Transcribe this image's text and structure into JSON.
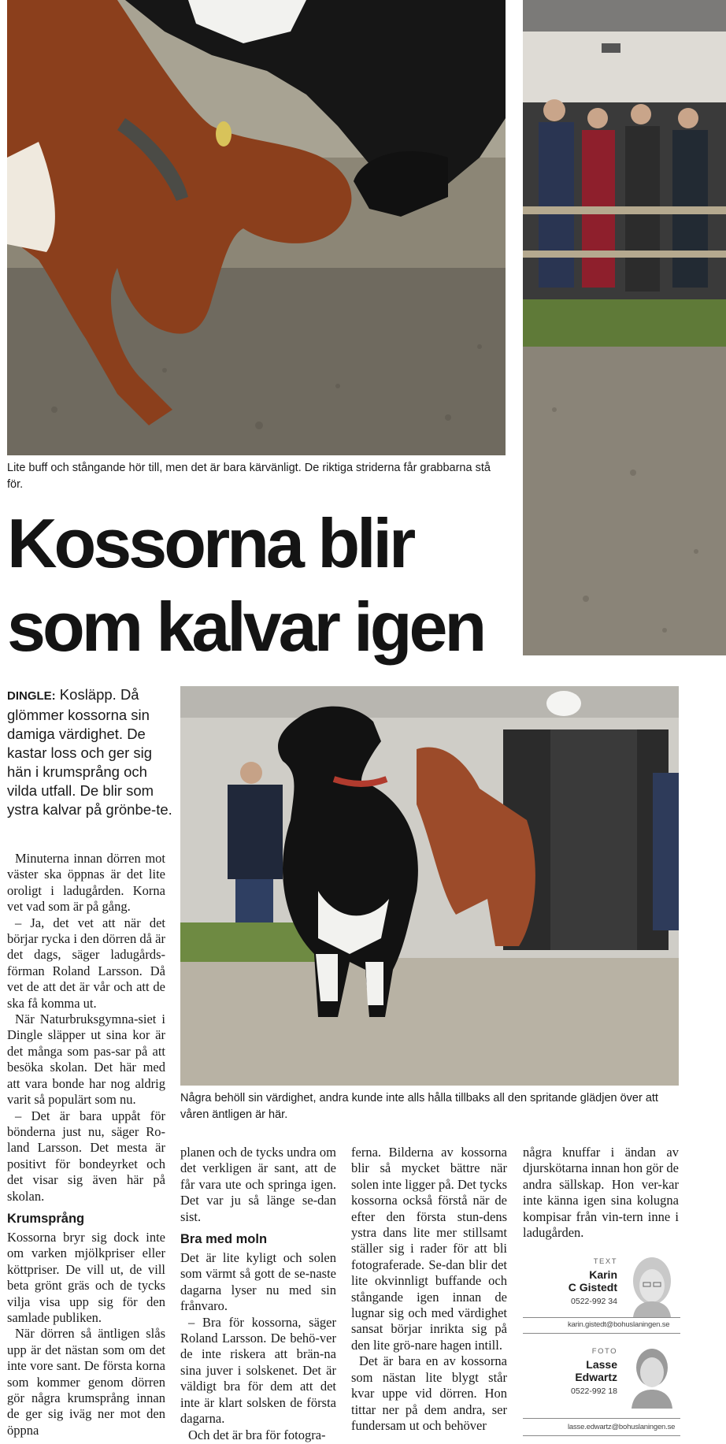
{
  "photos": {
    "top_caption": "Lite buff och stångande hör till, men det är bara kärvänligt. De riktiga striderna får grabbarna stå för.",
    "mid_caption": "Några behöll sin värdighet, andra kunde inte alls hålla tillbaks all den spritande glädjen över att våren äntligen är här."
  },
  "headline": {
    "line1": "Kossorna blir",
    "line2": "som kalvar igen"
  },
  "lead": {
    "dateline": "DINGLE:",
    "text": " Kosläpp. Då glömmer kossorna sin damiga värdighet. De kastar loss och ger sig hän i krumsprång och vilda utfall. De blir som ystra kalvar på grönbe-te."
  },
  "body": {
    "col1": [
      "Minuterna innan dörren mot väster ska öppnas är det lite oroligt i ladugården. Korna vet vad som är på gång.",
      "– Ja, det vet att när det börjar rycka i den dörren då är det dags, säger ladugårds-förman Roland Larsson. Då vet de att det är vår och att de ska få komma ut.",
      "När Naturbruksgymna-siet i Dingle släpper ut sina kor är det många som pas-sar på att besöka skolan. Det här med att vara bonde har nog aldrig varit så populärt som nu.",
      "– Det är bara uppåt för bönderna just nu, säger Ro-land Larsson. Det mesta är positivt för bondeyrket och det visar sig även här på skolan."
    ],
    "subhead1": "Krumsprång",
    "col1b": [
      "Kossorna bryr sig dock inte om varken mjölkpriser eller köttpriser. De vill ut, de vill beta grönt gräs och de tycks vilja visa upp sig för den samlade publiken.",
      "När dörren så äntligen slås upp är det nästan som om det inte vore sant. De första korna som kommer genom dörren gör några krumsprång innan de ger sig iväg ner mot den öppna"
    ],
    "col2a": "planen och de tycks undra om det verkligen är sant, att de får vara ute och springa igen. Det var ju så länge se-dan sist.",
    "subhead2": "Bra med moln",
    "col2": [
      "Det är lite kyligt och solen som värmt så gott de se-naste dagarna lyser nu med sin frånvaro.",
      "– Bra för kossorna, säger Roland Larsson. De behö-ver de inte riskera att brän-na sina juver i solskenet. Det är väldigt bra för dem att det inte är klart solsken de första dagarna.",
      "Och det är bra för fotogra-"
    ],
    "col3": [
      "ferna. Bilderna av kossorna blir så mycket bättre när solen inte ligger på. Det tycks kossorna också förstå när de efter den första stun-dens ystra dans lite mer stillsamt ställer sig i rader för att bli fotograferade. Se-dan blir det lite okvinnligt buffande och stångande igen innan de lugnar sig och med värdighet sansat börjar inrikta sig på den lite grö-nare hagen intill.",
      "Det är bara en av kossorna som nästan lite blygt står kvar uppe vid dörren. Hon tittar ner på dem andra, ser fundersam ut och behöver"
    ],
    "col4": "några knuffar i ändan av djurskötarna innan hon gör de andra sällskap. Hon ver-kar inte känna igen sina kolugna kompisar från vin-tern inne i ladugården."
  },
  "bylines": {
    "text": {
      "role": "TEXT",
      "name_line1": "Karin",
      "name_line2": "C Gistedt",
      "phone": "0522-992 34",
      "email": "karin.gistedt@bohuslaningen.se"
    },
    "photo": {
      "role": "FOTO",
      "name_line1": "Lasse",
      "name_line2": "Edwartz",
      "phone": "0522-992 18",
      "email": "lasse.edwartz@bohuslaningen.se"
    }
  }
}
